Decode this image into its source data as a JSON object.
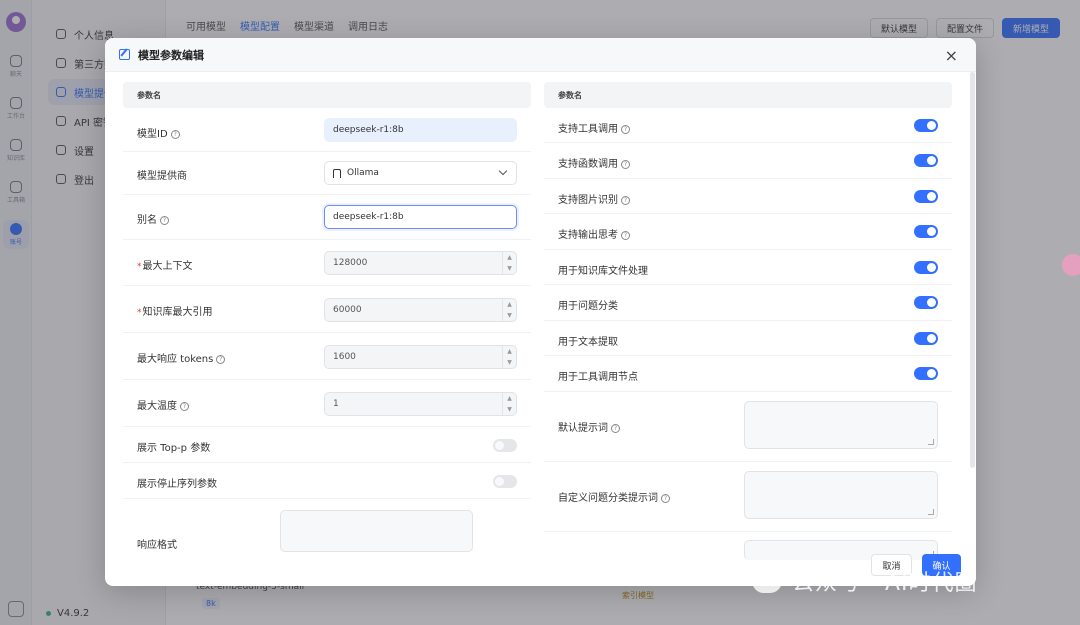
{
  "rail": {
    "items": [
      {
        "label": "聊天",
        "icon": "chat-icon"
      },
      {
        "label": "工作台",
        "icon": "robot-icon"
      },
      {
        "label": "知识库",
        "icon": "database-icon"
      },
      {
        "label": "工具箱",
        "icon": "toolbox-icon"
      },
      {
        "label": "账号",
        "icon": "user-icon"
      }
    ]
  },
  "sidebar": {
    "items": [
      {
        "label": "个人信息",
        "icon": "user-icon"
      },
      {
        "label": "第三方账号",
        "icon": "cube-icon"
      },
      {
        "label": "模型提供商",
        "icon": "model-icon"
      },
      {
        "label": "API 密钥",
        "icon": "key-icon"
      },
      {
        "label": "设置",
        "icon": "gear-icon"
      },
      {
        "label": "登出",
        "icon": "logout-icon"
      }
    ],
    "version": "V4.9.2"
  },
  "topbar": {
    "tabs": [
      "可用模型",
      "模型配置",
      "模型渠道",
      "调用日志"
    ],
    "actions": [
      "默认模型",
      "配置文件",
      "新增模型"
    ]
  },
  "background": {
    "row_text": "text-embedding-3-small",
    "badge": "8k",
    "tag": "索引模型"
  },
  "modal": {
    "title": "模型参数编辑",
    "close": "×",
    "left_header": "参数名",
    "right_header": "参数名",
    "left_rows": [
      {
        "label": "模型ID",
        "value": "deepseek-r1:8b"
      },
      {
        "label": "模型提供商",
        "value": "Ollama"
      },
      {
        "label": "别名",
        "value": "deepseek-r1:8b"
      },
      {
        "label": "最大上下文",
        "value": "128000"
      },
      {
        "label": "知识库最大引用",
        "value": "60000"
      },
      {
        "label": "最大响应 tokens",
        "value": "1600"
      },
      {
        "label": "最大温度",
        "value": "1"
      },
      {
        "label": "展示 Top-p 参数"
      },
      {
        "label": "展示停止序列参数"
      },
      {
        "label": "响应格式"
      }
    ],
    "right_rows": [
      {
        "label": "支持工具调用"
      },
      {
        "label": "支持函数调用"
      },
      {
        "label": "支持图片识别"
      },
      {
        "label": "支持输出思考"
      },
      {
        "label": "用于知识库文件处理"
      },
      {
        "label": "用于问题分类"
      },
      {
        "label": "用于文本提取"
      },
      {
        "label": "用于工具调用节点"
      },
      {
        "label": "默认提示词"
      },
      {
        "label": "自定义问题分类提示词"
      }
    ],
    "cancel": "取消",
    "confirm": "确认"
  },
  "watermark": "公众号 · AI时代圈"
}
